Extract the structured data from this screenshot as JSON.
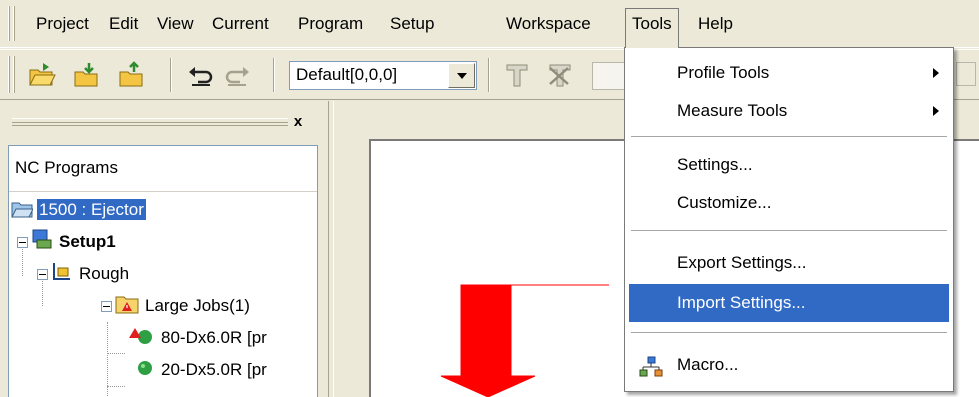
{
  "menubar": {
    "items": [
      "Project",
      "Edit",
      "View",
      "Current",
      "Program",
      "Setup",
      "Workspace",
      "Tools",
      "Help"
    ],
    "open_item": "Tools"
  },
  "toolbar": {
    "combo_value": "Default[0,0,0]",
    "icons": [
      "open-folder-icon",
      "open-folder-down-icon",
      "open-folder-up-icon",
      "undo-icon",
      "redo-icon",
      "tool-icon",
      "tool-delete-icon"
    ]
  },
  "panel": {
    "close_label": "x",
    "header": "NC Programs",
    "tree": [
      {
        "label": "1500 : Ejector",
        "icon": "folder-icon"
      },
      {
        "label": "Setup1",
        "icon": "setup-icon"
      },
      {
        "label": "Rough",
        "icon": "rough-icon"
      },
      {
        "label": "Large Jobs(1)",
        "icon": "warning-folder-icon"
      },
      {
        "label": "80-Dx6.0R [pr",
        "icon": "error-job-icon"
      },
      {
        "label": "20-Dx5.0R [pr",
        "icon": "ok-job-icon"
      }
    ]
  },
  "dropdown": {
    "items": [
      {
        "label": "Profile Tools",
        "submenu": true
      },
      {
        "label": "Measure Tools",
        "submenu": true
      },
      {
        "label": "Settings..."
      },
      {
        "label": "Customize..."
      },
      {
        "label": "Export Settings..."
      },
      {
        "label": "Import Settings...",
        "highlighted": true
      },
      {
        "label": "Macro...",
        "icon": "macro-icon"
      }
    ]
  },
  "colors": {
    "highlight": "#316ac5",
    "arrow": "#ff0000",
    "chrome": "#ece9d8"
  }
}
